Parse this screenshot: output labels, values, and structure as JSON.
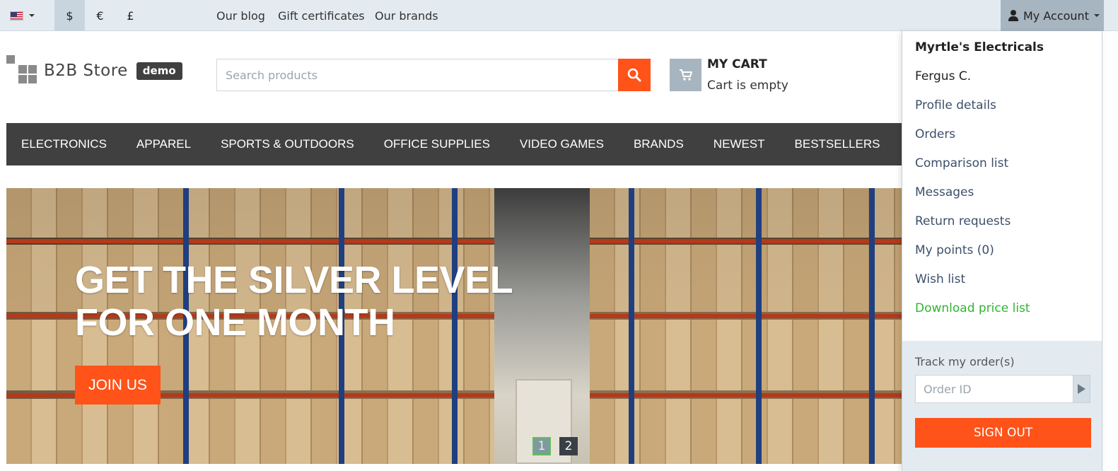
{
  "topbar": {
    "language_flag": "us-flag-icon",
    "currencies": [
      "$",
      "€",
      "£"
    ],
    "active_currency": "$",
    "links": [
      "Our blog",
      "Gift certificates",
      "Our brands"
    ],
    "account_label": "My Account"
  },
  "header": {
    "logo_text": "B2B Store",
    "badge": "demo",
    "search_placeholder": "Search products",
    "cart_title": "MY CART",
    "cart_status": "Cart is empty"
  },
  "nav": {
    "items": [
      "ELECTRONICS",
      "APPAREL",
      "SPORTS & OUTDOORS",
      "OFFICE SUPPLIES",
      "VIDEO GAMES",
      "BRANDS",
      "NEWEST",
      "BESTSELLERS"
    ]
  },
  "banner": {
    "title_line1": "GET THE SILVER LEVEL",
    "title_line2": "FOR ONE MONTH",
    "cta": "JOIN US",
    "pages": [
      "1",
      "2"
    ],
    "active_page": "1"
  },
  "account_menu": {
    "company": "Myrtle's Electricals",
    "user": "Fergus C.",
    "items": [
      "Profile details",
      "Orders",
      "Comparison list",
      "Messages",
      "Return requests",
      "My points (0)",
      "Wish list"
    ],
    "download": "Download price list",
    "track_label": "Track my order(s)",
    "order_placeholder": "Order ID",
    "sign_out": "SIGN OUT"
  },
  "colors": {
    "accent": "#ff5319",
    "nav_bg": "#404040",
    "topbar_bg": "#e3ebf1",
    "link_green": "#2fb52f"
  }
}
